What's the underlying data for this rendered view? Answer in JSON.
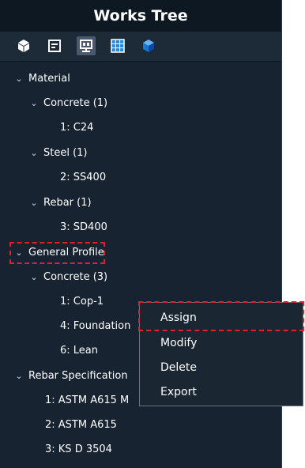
{
  "panel": {
    "title": "Works Tree"
  },
  "toolbar": {
    "tools": [
      {
        "icon": "cube-icon"
      },
      {
        "icon": "document-icon"
      },
      {
        "icon": "monitor-icon",
        "active": true
      },
      {
        "icon": "grid-icon"
      },
      {
        "icon": "box-3d-icon"
      }
    ]
  },
  "tree": {
    "material": "Material",
    "concrete": "Concrete (1)",
    "c24": "1: C24",
    "steel": "Steel (1)",
    "ss400": "2: SS400",
    "rebar": "Rebar (1)",
    "sd400": "3: SD400",
    "general_profile": "General Profile",
    "gp_concrete": "Concrete (3)",
    "cop1": "1: Cop-1",
    "foundation": "4: Foundation",
    "lean": "6: Lean",
    "rebar_spec": "Rebar Specification",
    "astm_m": "1: ASTM A615 M",
    "astm": "2: ASTM A615",
    "ksd": "3: KS D 3504"
  },
  "context_menu": {
    "assign": "Assign",
    "modify": "Modify",
    "delete": "Delete",
    "export": "Export"
  },
  "colors": {
    "panel_bg": "#172331",
    "title_bg": "#0e1822",
    "highlight_border": "#e0202c"
  }
}
